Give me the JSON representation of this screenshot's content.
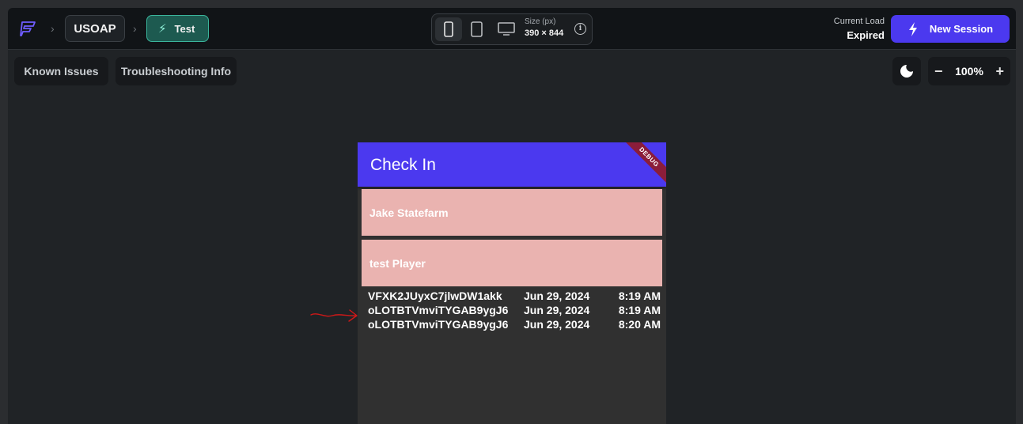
{
  "topbar": {
    "breadcrumbs": [
      "USOAP",
      "Test"
    ],
    "device_size_label": "Size (px)",
    "device_size_value": "390 × 844",
    "current_load_label": "Current Load",
    "current_load_value": "Expired",
    "new_session_label": "New Session"
  },
  "toolbar": {
    "known_issues": "Known Issues",
    "troubleshooting": "Troubleshooting Info",
    "zoom_value": "100%"
  },
  "app": {
    "title": "Check In",
    "debug_banner": "DEBUG",
    "players": [
      "Jake Statefarm",
      "test Player"
    ],
    "rows": [
      {
        "id": "VFXK2JUyxC7jlwDW1akk",
        "date": "Jun 29, 2024",
        "time": "8:19 AM"
      },
      {
        "id": "oLOTBTVmviTYGAB9ygJ6",
        "date": "Jun 29, 2024",
        "time": "8:19 AM"
      },
      {
        "id": "oLOTBTVmviTYGAB9ygJ6",
        "date": "Jun 29, 2024",
        "time": "8:20 AM"
      }
    ]
  },
  "colors": {
    "brand": "#4b39ef",
    "player_tile": "#eab3b0",
    "annotation": "#d01818"
  }
}
